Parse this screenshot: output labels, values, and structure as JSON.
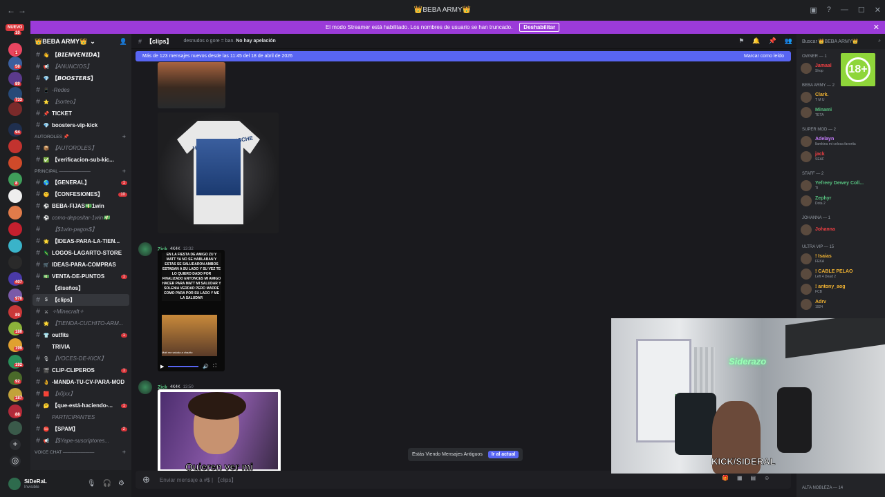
{
  "titlebar": {
    "title": "👑BEBA ARMY👑"
  },
  "streamer": {
    "text": "El modo Streamer está habilitado. Los nombres de usuario se han truncado.",
    "button": "Deshabilitar"
  },
  "guilds": {
    "nuevo": "NUEVO",
    "badges": [
      "10",
      "1",
      "58",
      "89",
      "733",
      "94",
      "8",
      "407",
      "970",
      "89",
      "180",
      "199",
      "192",
      "92",
      "187",
      "88"
    ]
  },
  "server": {
    "name": "👑BEBA ARMY👑"
  },
  "channels": [
    {
      "name": "【𝘽𝙄𝙀𝙉𝙑𝙀𝙉𝙄𝘿𝘼】",
      "icon": "👋",
      "bold": true
    },
    {
      "name": "【ANUNCIOS】",
      "icon": "📢",
      "bold": false
    },
    {
      "name": "【𝘽𝙊𝙊𝙎𝙏𝙀𝙍𝙎】",
      "icon": "💎",
      "bold": true
    },
    {
      "name": "-Redes",
      "icon": "📱",
      "bold": false
    },
    {
      "name": "【sorteo】",
      "icon": "⭐",
      "bold": false
    },
    {
      "name": "TICKET",
      "icon": "📌",
      "bold": true
    },
    {
      "name": "boosters-vip-kick",
      "icon": "💎",
      "bold": true
    }
  ],
  "cat_autoroles": "AUTOROLES 📌",
  "channels2": [
    {
      "name": "【AUTOROLES】",
      "icon": "📦",
      "bold": false
    },
    {
      "name": "【verificacion-sub-kic...",
      "icon": "✅",
      "bold": true
    }
  ],
  "cat_principal": "PRINCIPAL ———————",
  "channels3": [
    {
      "name": "【GENERAL】",
      "icon": "🌎",
      "bold": true,
      "badge": "1"
    },
    {
      "name": "【CONFESIONES】",
      "icon": "🤫",
      "bold": true,
      "badge": "10"
    },
    {
      "name": "BEBA-FIJAS💵1win",
      "icon": "⚽",
      "bold": true,
      "badge": ""
    },
    {
      "name": "como-depositar-1win💵",
      "icon": "⚽",
      "bold": false,
      "badge": ""
    },
    {
      "name": "【$1win-pagos$】",
      "icon": "",
      "bold": false,
      "badge": ""
    },
    {
      "name": "【IDEAS-PARA-LA-TIEN...",
      "icon": "🌟",
      "bold": true,
      "badge": ""
    },
    {
      "name": "LOGOS-LAGARTO-STORE",
      "icon": "🦎",
      "bold": true,
      "badge": ""
    },
    {
      "name": "IDEAS-PARA-COMPRAS",
      "icon": "🛒",
      "bold": true,
      "badge": ""
    },
    {
      "name": "VENTA-DE-PUNTOS",
      "icon": "💵",
      "bold": true,
      "badge": "1"
    },
    {
      "name": "【diseños】",
      "icon": "",
      "bold": true,
      "badge": ""
    },
    {
      "name": "【clips】",
      "icon": "$",
      "bold": true,
      "badge": "",
      "selected": true
    },
    {
      "name": "✧Minecraft✧",
      "icon": "⚔",
      "bold": false,
      "badge": ""
    },
    {
      "name": "【TIENDA-CUCHITO-ARM...",
      "icon": "🌟",
      "bold": false,
      "badge": ""
    },
    {
      "name": "outfits",
      "icon": "👕",
      "bold": true,
      "badge": "1"
    },
    {
      "name": "TRIVIA",
      "icon": "",
      "bold": true,
      "badge": ""
    },
    {
      "name": "【VOCES-DE-KICK】",
      "icon": "🎙",
      "bold": false,
      "badge": ""
    },
    {
      "name": "CLIP-CLIPEROS",
      "icon": "🎬",
      "bold": true,
      "badge": "1"
    },
    {
      "name": "-MANDA-TU-CV-PARA-MOD",
      "icon": "👌",
      "bold": true,
      "badge": ""
    },
    {
      "name": "【x0jxx】",
      "icon": "🟥",
      "bold": false,
      "badge": ""
    },
    {
      "name": "【que-está-haciendo-...",
      "icon": "🤔",
      "bold": true,
      "badge": "1"
    },
    {
      "name": "PARTICIPANTES",
      "icon": "",
      "bold": false,
      "badge": ""
    },
    {
      "name": "【SPAM】",
      "icon": "⛔",
      "bold": true,
      "badge": "2"
    },
    {
      "name": "【$Yape-suscriptores...",
      "icon": "📢",
      "bold": false,
      "badge": ""
    }
  ],
  "cat_voice": "VOICE CHAT ———————",
  "user": {
    "name": "SiDeRaL",
    "status": "Invisible"
  },
  "channel_header": {
    "name": "【clips】",
    "topic_pre": "desnudos o gore = ban.",
    "topic_bold": "No hay apelación"
  },
  "newbar": {
    "text": "Más de 123 mensajes nuevos desde las 11:45 del 18 de abril de 2026",
    "mark": "Marcar como leído"
  },
  "img2_print": "HERMANOS BRUSCHE",
  "messages": [
    {
      "author": "Zick",
      "tag": "4K4K",
      "time": "13:32"
    },
    {
      "author": "Zick",
      "tag": "4K4K",
      "time": "13:50"
    }
  ],
  "video_caption": "EN LA FIESTA DE AMIGO ZU Y MATT YA NO SE HABLABAN Y ESTAS SE SALUDARON AMBOS ESTABAN A SU LADO Y SU VEZ TE LO QUIERO DADO POR FINALIZADO ENTONCES MI AMIGO HACER PARA MATT MI SALUDAR Y SOLENIA VERDAD PERO MADRE COMO PARA POR SU LADO Y ME LA SALUDAR",
  "video_sub": "Matt me saluda a chazito",
  "img3_caption": "Quieren ver mi",
  "old_messages": {
    "text": "Estás Viendo Mensajes Antiguos",
    "button": "Ir al actual"
  },
  "composer": {
    "placeholder": "Enviar mensaje a #$ | 【clips】"
  },
  "members_search": "Buscar 👑BEBA ARMY👑",
  "member_groups": [
    {
      "label": "OWNER — 1",
      "members": [
        {
          "name": "Jamaal",
          "color": "#f23f43",
          "sub": "Shop"
        }
      ]
    },
    {
      "label": "BEBA ARMY — 2",
      "members": [
        {
          "name": "Clark.",
          "color": "#f0b232",
          "sub": "T M U"
        },
        {
          "name": "Minami",
          "color": "#57c07f",
          "sub": "TETA"
        }
      ]
    },
    {
      "label": "SUPER MOD — 2",
      "members": [
        {
          "name": "Adelayn",
          "color": "#c77dff",
          "sub": "llamkina mi celosa favorita"
        },
        {
          "name": "jack",
          "color": "#f23f43",
          "sub": "SEAF"
        }
      ]
    },
    {
      "label": "STAFF — 2",
      "members": [
        {
          "name": "Yefreey Dewey Coll...",
          "color": "#57c07f",
          "sub": "TI"
        },
        {
          "name": "Zephyr",
          "color": "#57c07f",
          "sub": "Dota 2"
        }
      ]
    },
    {
      "label": "Johanna — 1",
      "members": [
        {
          "name": "Johanna",
          "color": "#f23f43",
          "sub": ""
        }
      ]
    },
    {
      "label": "ULTRA VIP — 15",
      "members": [
        {
          "name": "! Isaias",
          "color": "#f0b232",
          "sub": "FEKA"
        },
        {
          "name": "! CABLE PELAO",
          "color": "#f0b232",
          "sub": "Left 4 Dead 2"
        },
        {
          "name": "! antony_aog",
          "color": "#f0b232",
          "sub": "FCB"
        },
        {
          "name": "Adrv",
          "color": "#f0b232",
          "sub": "1924"
        }
      ]
    }
  ],
  "badge18": "18+",
  "stream": {
    "neon": "Siderazo",
    "overlay": "KICK/SIDERAL"
  },
  "alta_nobleza": "ALTA NOBLEZA — 14"
}
